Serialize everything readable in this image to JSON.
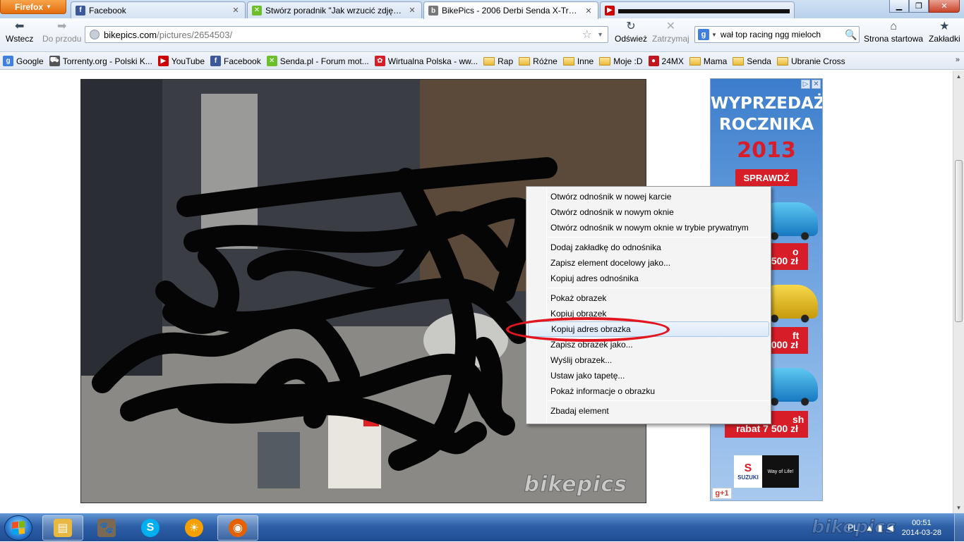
{
  "browser": {
    "app_button": "Firefox",
    "tabs": [
      {
        "label": "Facebook",
        "icon": "facebook-icon",
        "color": "#3b5998",
        "active": false
      },
      {
        "label": "Stwórz poradnik \"Jak wrzucić zdjęcie ...",
        "icon": "senda-icon",
        "color": "#6cbf2a",
        "active": false
      },
      {
        "label": "BikePics - 2006 Derbi Senda X-Treme ...",
        "icon": "bikepics-icon",
        "color": "#666666",
        "active": true
      },
      {
        "label": "",
        "icon": "youtube-icon",
        "color": "#cc0000",
        "active": false
      }
    ],
    "toolbar": {
      "back": "Wstecz",
      "forward": "Do przodu",
      "reload": "Odśwież",
      "stop": "Zatrzymaj",
      "home": "Strona startowa",
      "bookmarks": "Zakładki"
    },
    "url": {
      "domain": "bikepics.com",
      "path": "/pictures/2654503/"
    },
    "search": {
      "engine": "g",
      "value": "wał top racing ngg mieloch"
    },
    "bookmarks_bar": [
      {
        "label": "Google",
        "icon": "google-icon",
        "color": "#3f7fe0"
      },
      {
        "label": "Torrenty.org - Polski K...",
        "icon": "torrent-icon",
        "color": "#555555"
      },
      {
        "label": "YouTube",
        "icon": "youtube-icon",
        "color": "#cc0000"
      },
      {
        "label": "Facebook",
        "icon": "facebook-icon",
        "color": "#3b5998"
      },
      {
        "label": "Senda.pl - Forum mot...",
        "icon": "senda-icon",
        "color": "#6cbf2a"
      },
      {
        "label": "Wirtualna Polska - ww...",
        "icon": "wp-icon",
        "color": "#d71e28"
      },
      {
        "label": "Rap",
        "icon": "folder-icon",
        "color": ""
      },
      {
        "label": "Różne",
        "icon": "folder-icon",
        "color": ""
      },
      {
        "label": "Inne",
        "icon": "folder-icon",
        "color": ""
      },
      {
        "label": "Moje :D",
        "icon": "folder-icon",
        "color": ""
      },
      {
        "label": "24MX",
        "icon": "24mx-icon",
        "color": "#c0161d"
      },
      {
        "label": "Mama",
        "icon": "folder-icon",
        "color": ""
      },
      {
        "label": "Senda",
        "icon": "folder-icon",
        "color": ""
      },
      {
        "label": "Ubranie Cross",
        "icon": "folder-icon",
        "color": ""
      }
    ]
  },
  "page": {
    "photo_watermark": "bikepics",
    "ad": {
      "headline_line1": "WYPRZEDAŻ",
      "headline_line2": "ROCZNIKA",
      "year": "2013",
      "cta": "SPRAWDŹ",
      "prices": [
        "o",
        "500 zł",
        "ft",
        "000 zł",
        "sh",
        "rabat 7 500 zł"
      ],
      "brand": "SUZUKI",
      "slogan": "Way of Life!",
      "gplus": "g+1"
    }
  },
  "context_menu": {
    "groups": [
      [
        "Otwórz odnośnik w nowej karcie",
        "Otwórz odnośnik w nowym oknie",
        "Otwórz odnośnik w nowym oknie w trybie prywatnym"
      ],
      [
        "Dodaj zakładkę do odnośnika",
        "Zapisz element docelowy jako...",
        "Kopiuj adres odnośnika"
      ],
      [
        "Pokaż obrazek",
        "Kopiuj obrazek",
        "Kopiuj adres obrazka",
        "Zapisz obrazek jako...",
        "Wyślij obrazek...",
        "Ustaw jako tapetę...",
        "Pokaż informacje o obrazku"
      ],
      [
        "Zbadaj element"
      ]
    ],
    "highlighted": "Kopiuj adres obrazka",
    "annotation_color": "#e3151e"
  },
  "taskbar": {
    "language": "PL",
    "time": "00:51",
    "date": "2014-03-28",
    "pinned": [
      {
        "name": "explorer-icon",
        "color": "#e8b840"
      },
      {
        "name": "gimp-icon",
        "color": "#7a6a55"
      },
      {
        "name": "skype-icon",
        "color": "#00aff0"
      },
      {
        "name": "sun-icon",
        "color": "#f5a000"
      },
      {
        "name": "firefox-icon",
        "color": "#e66000"
      }
    ],
    "watermark": "bikepics"
  }
}
